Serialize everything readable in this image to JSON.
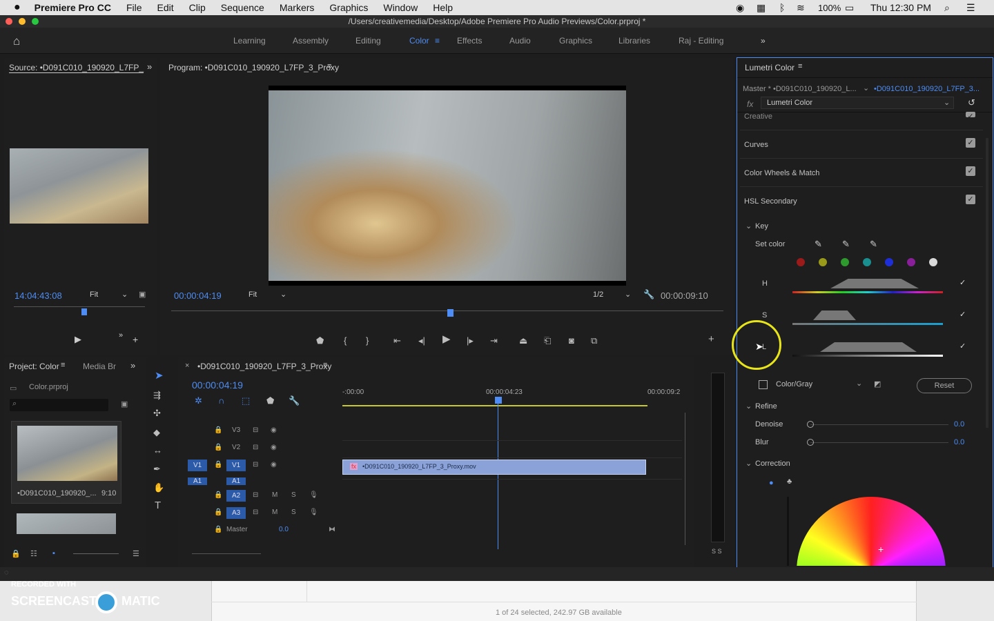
{
  "mac": {
    "app": "Premiere Pro CC",
    "menus": [
      "File",
      "Edit",
      "Clip",
      "Sequence",
      "Markers",
      "Graphics",
      "Window",
      "Help"
    ],
    "battery": "100%",
    "clock": "Thu 12:30 PM"
  },
  "title": "/Users/creativemedia/Desktop/Adobe Premiere Pro Audio Previews/Color.prproj *",
  "workspaces": [
    "Learning",
    "Assembly",
    "Editing",
    "Color",
    "Effects",
    "Audio",
    "Graphics",
    "Libraries",
    "Raj - Editing"
  ],
  "active_workspace": "Color",
  "source": {
    "tab": "Source: •D091C010_190920_L7FP_",
    "timecode": "14:04:43:08",
    "zoom": "Fit"
  },
  "program": {
    "tab": "Program: •D091C010_190920_L7FP_3_Proxy",
    "timecode": "00:00:04:19",
    "zoom": "Fit",
    "resolution": "1/2",
    "duration": "00:00:09:10"
  },
  "project": {
    "tab": "Project: Color",
    "tab2": "Media Br",
    "file": "Color.prproj",
    "clip_name": "•D091C010_190920_...",
    "clip_duration": "9:10"
  },
  "timeline": {
    "tab": "•D091C010_190920_L7FP_3_Proxy",
    "timecode": "00:00:04:19",
    "ruler": [
      "-:00:00",
      "00:00:04:23",
      "00:00:09:2"
    ],
    "clip": "•D091C010_190920_L7FP_3_Proxy.mov",
    "tracks": [
      "V3",
      "V2",
      "V1",
      "A1",
      "A2",
      "A3"
    ],
    "master_label": "Master",
    "master_value": "0.0",
    "src_v": "V1",
    "src_a": "A1",
    "m": "M",
    "s": "S",
    "meter": "S S"
  },
  "lumetri": {
    "tab": "Lumetri Color",
    "master": "Master * •D091C010_190920_L...",
    "clip": "•D091C010_190920_L7FP_3...",
    "effect": "Lumetri Color",
    "fx": "fx",
    "sections": [
      "Creative",
      "Curves",
      "Color Wheels & Match",
      "HSL Secondary"
    ],
    "key": "Key",
    "set_color": "Set color",
    "swatches": [
      "#9b1b1b",
      "#9a9a1a",
      "#2e9a2e",
      "#1a8f8f",
      "#1f2fd8",
      "#8a1f9a",
      "#d9d9d9"
    ],
    "h": "H",
    "s": "S",
    "l": "L",
    "color_gray": "Color/Gray",
    "reset": "Reset",
    "refine": "Refine",
    "denoise": "Denoise",
    "denoise_val": "0.0",
    "blur": "Blur",
    "blur_val": "0.0",
    "correction": "Correction"
  },
  "finder": "1 of 24 selected, 242.97 GB available",
  "watermark": {
    "line1": "RECORDED WITH",
    "line2": "SCREENCAST",
    "line3": "MATIC"
  }
}
